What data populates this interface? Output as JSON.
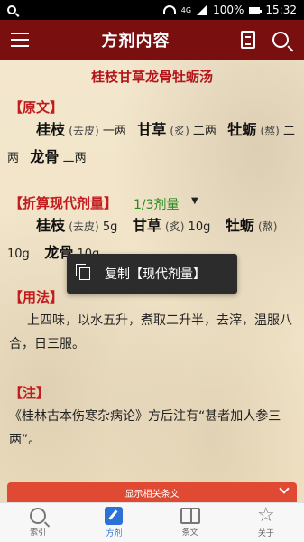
{
  "status_bar": {
    "battery": "100%",
    "time": "15:32",
    "network": "4G"
  },
  "app_bar": {
    "title": "方剂内容"
  },
  "formula": {
    "name": "桂枝甘草龙骨牡蛎汤"
  },
  "original": {
    "heading": "【原文】",
    "herbs": [
      {
        "name": "桂枝",
        "note": "(去皮)",
        "dose": "一两"
      },
      {
        "name": "甘草",
        "note": "(炙)",
        "dose": "二两"
      },
      {
        "name": "牡蛎",
        "note": "(熬)",
        "dose": "二两"
      },
      {
        "name": "龙骨",
        "note": "",
        "dose": "二两"
      }
    ]
  },
  "modern": {
    "heading": "【折算现代剂量】",
    "ratio": "1/3剂量",
    "ratio_arrow": "▼",
    "herbs": [
      {
        "name": "桂枝",
        "note": "(去皮)",
        "dose": "5g"
      },
      {
        "name": "甘草",
        "note": "(炙)",
        "dose": "10g"
      },
      {
        "name": "牡蛎",
        "note": "(熬)",
        "dose": "10g"
      },
      {
        "name": "龙骨",
        "note": "",
        "dose": "10g"
      }
    ]
  },
  "usage": {
    "heading": "【用法】",
    "text": "上四味，以水五升，煮取二升半，去滓，温服八合，日三服。"
  },
  "annotation": {
    "heading": "【注】",
    "text": "《桂林古本伤寒杂病论》方后注有“甚者加人参三两”。"
  },
  "tooltip": {
    "label": "复制【现代剂量】"
  },
  "related": {
    "label": "显示相关条文"
  },
  "bottom_nav": [
    {
      "label": "索引",
      "icon": "search-icon"
    },
    {
      "label": "方剂",
      "icon": "edit-icon"
    },
    {
      "label": "条文",
      "icon": "book-icon"
    },
    {
      "label": "关于",
      "icon": "star-icon"
    }
  ],
  "colors": {
    "app_bar": "#7a0f10",
    "heading_red": "#c21a1e",
    "ratio_green": "#2a8a1e",
    "active_blue": "#2b72d6"
  }
}
